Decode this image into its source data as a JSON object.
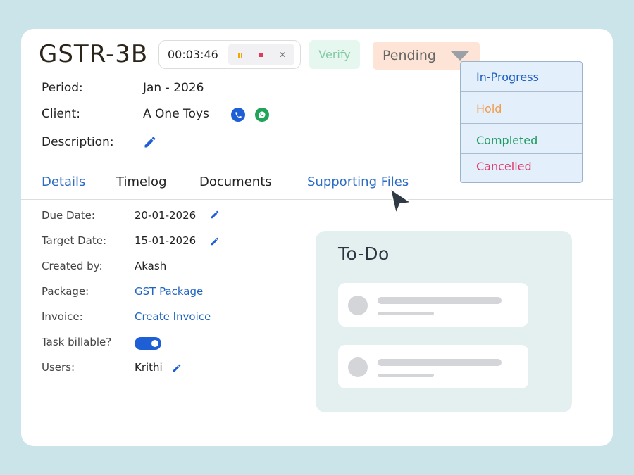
{
  "header": {
    "title": "GSTR-3B",
    "timer": "00:03:46",
    "verify_label": "Verify",
    "status": "Pending"
  },
  "info": {
    "period_label": "Period:",
    "period_value": "Jan - 2026",
    "client_label": "Client:",
    "client_value": "A One Toys",
    "description_label": "Description:"
  },
  "tabs": [
    {
      "label": "Details"
    },
    {
      "label": "Timelog"
    },
    {
      "label": "Documents"
    },
    {
      "label": "Supporting Files"
    }
  ],
  "details": {
    "due_date_label": "Due Date:",
    "due_date_value": "20-01-2026",
    "target_date_label": "Target Date:",
    "target_date_value": "15-01-2026",
    "created_by_label": "Created by:",
    "created_by_value": "Akash",
    "package_label": "Package:",
    "package_value": "GST Package",
    "invoice_label": "Invoice:",
    "invoice_value": "Create Invoice",
    "billable_label": "Task billable?",
    "billable_on": true,
    "users_label": "Users:",
    "users_value": "Krithi"
  },
  "todo": {
    "title": "To-Do"
  },
  "status_options": [
    {
      "label": "In-Progress",
      "color": "#1f5fbf"
    },
    {
      "label": "Hold",
      "color": "#f29a48"
    },
    {
      "label": "Completed",
      "color": "#1f9a62"
    },
    {
      "label": "Cancelled",
      "color": "#e0386a"
    }
  ],
  "colors": {
    "accent": "#2064c2",
    "status_bg": "#fde4d6",
    "verify_bg": "#e6f7ef",
    "phone_icon": "#1f5fd6",
    "whatsapp_icon": "#22a35a"
  }
}
